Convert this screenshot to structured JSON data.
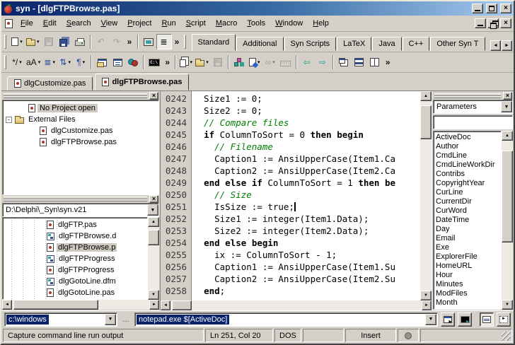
{
  "window": {
    "title": "syn - [dlgFTPBrowse.pas]"
  },
  "icons": {
    "close": "×",
    "up": "▲",
    "down": "▼",
    "left": "◄",
    "right": "►",
    "dropdown": "▾"
  },
  "menu": {
    "items": [
      "File",
      "Edit",
      "Search",
      "View",
      "Project",
      "Run",
      "Script",
      "Macro",
      "Tools",
      "Window",
      "Help"
    ]
  },
  "toolbar1": {
    "buttons": [
      {
        "name": "new-file",
        "icon": "new-page-icon",
        "kind": "page",
        "dropdown": true
      },
      {
        "name": "open-file",
        "icon": "open-folder-icon",
        "kind": "folder",
        "dropdown": true
      },
      {
        "name": "save-file",
        "icon": "save-icon",
        "kind": "floppy",
        "disabled": true
      },
      {
        "name": "save-all",
        "icon": "save-all-icon",
        "kind": "floppy2"
      },
      {
        "name": "print",
        "icon": "printer-icon",
        "kind": "printer"
      },
      {
        "sep": true
      },
      {
        "name": "undo",
        "icon": "undo-icon",
        "kind": "glyph",
        "glyph": "↶",
        "tone": "gray",
        "disabled": true
      },
      {
        "name": "redo",
        "icon": "redo-icon",
        "kind": "glyph",
        "glyph": "↷",
        "tone": "gray",
        "disabled": true
      },
      {
        "name": "more-standard",
        "icon": "chevron-more-icon",
        "kind": "glyph",
        "glyph": "»",
        "tone": "black",
        "chev": true
      },
      {
        "sep": true
      },
      {
        "name": "full-screen",
        "icon": "monitor-icon",
        "kind": "monitor"
      },
      {
        "name": "outline-view",
        "icon": "outline-icon",
        "kind": "glyph",
        "glyph": "≣",
        "tone": "black",
        "checked": true
      },
      {
        "name": "more-view",
        "icon": "chevron-more-icon",
        "kind": "glyph",
        "glyph": "»",
        "tone": "black",
        "chev": true
      }
    ]
  },
  "toolbar2": {
    "buttons": [
      {
        "name": "comment-toggle",
        "icon": "comment-icon",
        "kind": "glyph",
        "glyph": "*/",
        "tone": "black",
        "dropdown": true
      },
      {
        "name": "change-case",
        "icon": "case-icon",
        "kind": "glyph",
        "glyph": "aA",
        "tone": "black",
        "dropdown": true
      },
      {
        "name": "format-align",
        "icon": "align-icon",
        "kind": "glyph",
        "glyph": "≣",
        "tone": "blue",
        "dropdown": true
      },
      {
        "name": "sort-lines",
        "icon": "sort-icon",
        "kind": "glyph",
        "glyph": "⇅",
        "tone": "blue",
        "dropdown": true
      },
      {
        "name": "special-chars",
        "icon": "pilcrow-icon",
        "kind": "glyph",
        "glyph": "¶",
        "tone": "blue",
        "dropdown": true
      },
      {
        "sep": true
      },
      {
        "name": "copy-to-window",
        "icon": "window-folder-icon",
        "kind": "winfold"
      },
      {
        "name": "window-list",
        "icon": "window-list-icon",
        "kind": "winlist"
      },
      {
        "name": "syntax-colors",
        "icon": "colors-icon",
        "kind": "colors"
      },
      {
        "sep": true
      },
      {
        "name": "dos-console",
        "icon": "console-icon",
        "kind": "console"
      },
      {
        "name": "more-edit",
        "icon": "chevron-more-icon",
        "kind": "glyph",
        "glyph": "»",
        "tone": "black",
        "chev": true
      },
      {
        "sep": true
      },
      {
        "name": "copy-special",
        "icon": "pages-icon",
        "kind": "pages",
        "dropdown": true
      },
      {
        "name": "open-special",
        "icon": "open-folder-icon",
        "kind": "folder",
        "dropdown": true
      },
      {
        "name": "save-special",
        "icon": "save-icon",
        "kind": "floppy",
        "disabled": true
      },
      {
        "sep": true
      },
      {
        "name": "code-structure",
        "icon": "tree-nodes-icon",
        "kind": "tree"
      },
      {
        "name": "run-script",
        "icon": "script-run-icon",
        "kind": "script",
        "dropdown": true
      },
      {
        "name": "chain-link",
        "icon": "link-icon",
        "kind": "glyph",
        "glyph": "∞",
        "tone": "gray",
        "dropdown": true,
        "disabled": true
      },
      {
        "name": "keyboard-macro",
        "icon": "keyboard-icon",
        "kind": "keyboard",
        "disabled": true
      },
      {
        "sep": true
      },
      {
        "name": "nav-back",
        "icon": "arrow-left-icon",
        "kind": "glyph",
        "glyph": "⇦",
        "tone": "teal"
      },
      {
        "name": "nav-forward",
        "icon": "arrow-right-icon",
        "kind": "glyph",
        "glyph": "⇨",
        "tone": "teal"
      },
      {
        "sep": true
      },
      {
        "name": "cascade-windows",
        "icon": "cascade-icon",
        "kind": "cascade"
      },
      {
        "name": "tile-horizontal",
        "icon": "tile-horizontal-icon",
        "kind": "tileh"
      },
      {
        "name": "tile-vertical",
        "icon": "tile-vertical-icon",
        "kind": "tilev"
      },
      {
        "name": "more-window",
        "icon": "chevron-more-icon",
        "kind": "glyph",
        "glyph": "»",
        "tone": "black",
        "chev": true
      }
    ]
  },
  "syntax_tabs": {
    "active_index": 0,
    "tabs": [
      "Standard",
      "Additional",
      "Syn Scripts",
      "LaTeX",
      "Java",
      "C++",
      "Other Syn T"
    ]
  },
  "doc_tabs": {
    "active_index": 1,
    "tabs": [
      "dlgCustomize.pas",
      "dlgFTPBrowse.pas"
    ]
  },
  "project_panel": {
    "tree": [
      {
        "label": "No Project open",
        "level": 2,
        "icon": "syn-file-icon",
        "selected": true
      },
      {
        "label": "External Files",
        "level": 0,
        "icon": "open-folder-icon",
        "expander": "-"
      },
      {
        "label": "dlgCustomize.pas",
        "level": 3,
        "icon": "syn-file-icon"
      },
      {
        "label": "dlgFTPBrowse.pas",
        "level": 3,
        "icon": "syn-file-icon"
      }
    ]
  },
  "files_panel": {
    "path": "D:\\Delphi\\_Syn\\syn.v21",
    "files": [
      {
        "label": "dlgFTP.pas",
        "icon": "pas-file-icon"
      },
      {
        "label": "dlgFTPBrowse.d",
        "icon": "dfm-file-icon"
      },
      {
        "label": "dlgFTPBrowse.p",
        "icon": "pas-file-icon",
        "selected": true
      },
      {
        "label": "dlgFTPProgress",
        "icon": "dfm-file-icon"
      },
      {
        "label": "dlgFTPProgress",
        "icon": "pas-file-icon"
      },
      {
        "label": "dlgGotoLine.dfm",
        "icon": "dfm-file-icon"
      },
      {
        "label": "dlgGotoLine.pas",
        "icon": "pas-file-icon"
      }
    ]
  },
  "editor": {
    "lines": [
      {
        "num": "0242",
        "parts": [
          [
            "p",
            "  Size1 := 0;"
          ]
        ]
      },
      {
        "num": "0243",
        "parts": [
          [
            "p",
            "  Size2 := 0;"
          ]
        ]
      },
      {
        "num": "0244",
        "parts": [
          [
            "c",
            "  // Compare files"
          ]
        ]
      },
      {
        "num": "0245",
        "parts": [
          [
            "p",
            "  "
          ],
          [
            "k",
            "if"
          ],
          [
            "p",
            " ColumnToSort = 0 "
          ],
          [
            "k",
            "then"
          ],
          [
            "p",
            " "
          ],
          [
            "k",
            "begin"
          ]
        ]
      },
      {
        "num": "0246",
        "parts": [
          [
            "c",
            "    // Filename"
          ]
        ]
      },
      {
        "num": "0247",
        "parts": [
          [
            "p",
            "    Caption1 := AnsiUpperCase(Item1.Ca"
          ]
        ]
      },
      {
        "num": "0248",
        "parts": [
          [
            "p",
            "    Caption2 := AnsiUpperCase(Item2.Ca"
          ]
        ]
      },
      {
        "num": "0249",
        "parts": [
          [
            "p",
            "  "
          ],
          [
            "k",
            "end"
          ],
          [
            "p",
            " "
          ],
          [
            "k",
            "else"
          ],
          [
            "p",
            " "
          ],
          [
            "k",
            "if"
          ],
          [
            "p",
            " ColumnToSort = 1 "
          ],
          [
            "k",
            "then"
          ],
          [
            "p",
            " "
          ],
          [
            "k",
            "be"
          ]
        ]
      },
      {
        "num": "0250",
        "parts": [
          [
            "c",
            "    // Size"
          ]
        ]
      },
      {
        "num": "0251",
        "parts": [
          [
            "p",
            "    IsSize := true;"
          ]
        ],
        "cursor": true
      },
      {
        "num": "0252",
        "parts": [
          [
            "p",
            "    Size1 := integer(Item1.Data);"
          ]
        ]
      },
      {
        "num": "0253",
        "parts": [
          [
            "p",
            "    Size2 := integer(Item2.Data);"
          ]
        ]
      },
      {
        "num": "0254",
        "parts": [
          [
            "p",
            "  "
          ],
          [
            "k",
            "end"
          ],
          [
            "p",
            " "
          ],
          [
            "k",
            "else"
          ],
          [
            "p",
            " "
          ],
          [
            "k",
            "begin"
          ]
        ]
      },
      {
        "num": "0255",
        "parts": [
          [
            "p",
            "    ix := ColumnToSort - 1;"
          ]
        ]
      },
      {
        "num": "0256",
        "parts": [
          [
            "p",
            "    Caption1 := AnsiUpperCase(Item1.Su"
          ]
        ]
      },
      {
        "num": "0257",
        "parts": [
          [
            "p",
            "    Caption2 := AnsiUpperCase(Item2.Su"
          ]
        ]
      },
      {
        "num": "0258",
        "parts": [
          [
            "p",
            "  "
          ],
          [
            "k",
            "end"
          ],
          [
            "p",
            ";"
          ]
        ]
      }
    ]
  },
  "params_panel": {
    "category": "Parameters",
    "filter": "",
    "items": [
      "ActiveDoc",
      "Author",
      "CmdLine",
      "CmdLineWorkDir",
      "Contribs",
      "CopyrightYear",
      "CurLine",
      "CurrentDir",
      "CurWord",
      "DateTime",
      "Day",
      "Email",
      "Exe",
      "ExplorerFile",
      "HomeURL",
      "Hour",
      "Minutes",
      "ModFiles",
      "Month"
    ]
  },
  "command_bar": {
    "dir": "c:\\windows",
    "browse": "...",
    "command": "notepad.exe $[ActiveDoc]"
  },
  "status_bar": {
    "message": "Capture command line run output",
    "cursor": "Ln 251, Col 20",
    "mode": "DOS",
    "panel4": "",
    "edit_mode": "Insert"
  }
}
